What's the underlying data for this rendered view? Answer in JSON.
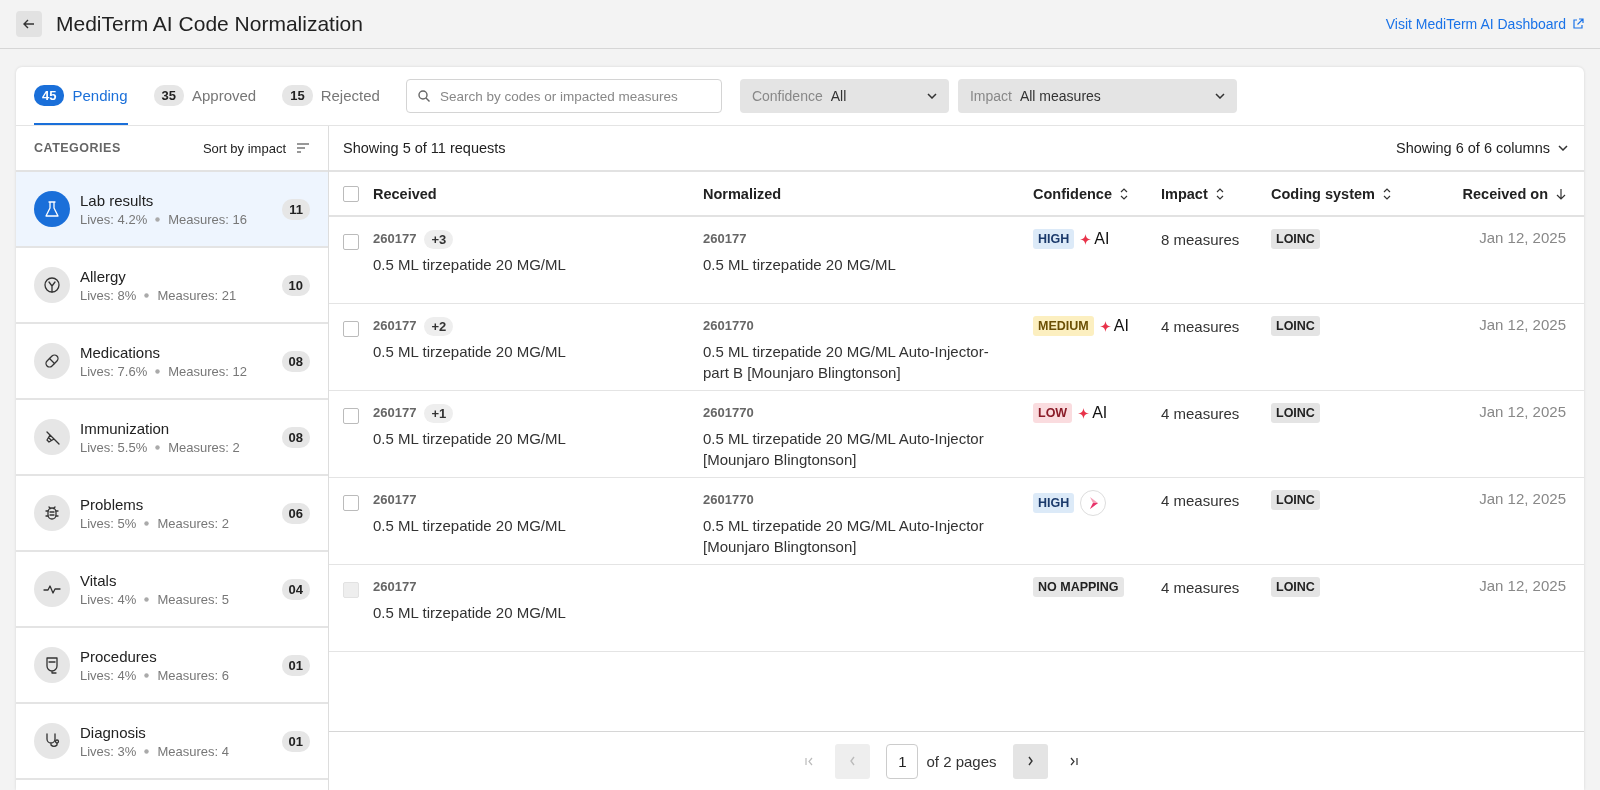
{
  "header": {
    "title": "MediTerm AI Code Normalization",
    "link": "Visit MediTerm AI Dashboard"
  },
  "tabs": [
    {
      "count": "45",
      "label": "Pending",
      "selected": true
    },
    {
      "count": "35",
      "label": "Approved",
      "selected": false
    },
    {
      "count": "15",
      "label": "Rejected",
      "selected": false
    }
  ],
  "search": {
    "placeholder": "Search by codes or impacted measures"
  },
  "filters": [
    {
      "label": "Confidence",
      "value": "All"
    },
    {
      "label": "Impact",
      "value": "All measures"
    }
  ],
  "sidebar": {
    "title": "CATEGORIES",
    "sort": "Sort by impact",
    "items": [
      {
        "name": "Lab results",
        "lives": "Lives: 4.2%",
        "measures": "Measures: 16",
        "count": "11",
        "selected": true
      },
      {
        "name": "Allergy",
        "lives": "Lives: 8%",
        "measures": "Measures: 21",
        "count": "10",
        "selected": false
      },
      {
        "name": "Medications",
        "lives": "Lives: 7.6%",
        "measures": "Measures: 12",
        "count": "08",
        "selected": false
      },
      {
        "name": "Immunization",
        "lives": "Lives: 5.5%",
        "measures": "Measures: 2",
        "count": "08",
        "selected": false
      },
      {
        "name": "Problems",
        "lives": "Lives: 5%",
        "measures": "Measures: 2",
        "count": "06",
        "selected": false
      },
      {
        "name": "Vitals",
        "lives": "Lives: 4%",
        "measures": "Measures: 5",
        "count": "04",
        "selected": false
      },
      {
        "name": "Procedures",
        "lives": "Lives: 4%",
        "measures": "Measures: 6",
        "count": "01",
        "selected": false
      },
      {
        "name": "Diagnosis",
        "lives": "Lives: 3%",
        "measures": "Measures: 4",
        "count": "01",
        "selected": false
      }
    ]
  },
  "table": {
    "summary": "Showing 5 of 11 requests",
    "columns_toggle": "Showing 6 of 6 columns",
    "select_all": {
      "checked": false
    },
    "columns": [
      {
        "label": "Received",
        "kind": "plain"
      },
      {
        "label": "Normalized",
        "kind": "plain"
      },
      {
        "label": "Confidence",
        "kind": "sortable"
      },
      {
        "label": "Impact",
        "kind": "sortable"
      },
      {
        "label": "Coding system",
        "kind": "sortable"
      },
      {
        "label": "Received on",
        "kind": "sorted"
      }
    ],
    "rows": [
      {
        "checked": false,
        "disabled": false,
        "received_code": "260177",
        "extra": "+3",
        "received_name": "0.5 ML tirzepatide 20 MG/ML",
        "normalized_code": "260177",
        "normalized_name": "0.5 ML tirzepatide 20 MG/ML",
        "confidence": {
          "kind": "high",
          "label": "HIGH"
        },
        "source": {
          "kind": "ai",
          "label": "AI"
        },
        "impact": "8 measures",
        "coding_system": "LOINC",
        "date": "Jan 12, 2025"
      },
      {
        "checked": false,
        "disabled": false,
        "received_code": "260177",
        "extra": "+2",
        "received_name": "0.5 ML tirzepatide 20 MG/ML",
        "normalized_code": "2601770",
        "normalized_name": "0.5 ML tirzepatide 20 MG/ML Auto-Injector-part B [Mounjaro Blingtonson]",
        "confidence": {
          "kind": "medium",
          "label": "MEDIUM"
        },
        "source": {
          "kind": "ai",
          "label": "AI"
        },
        "impact": "4 measures",
        "coding_system": "LOINC",
        "date": "Jan 12, 2025"
      },
      {
        "checked": false,
        "disabled": false,
        "received_code": "260177",
        "extra": "+1",
        "received_name": "0.5 ML tirzepatide 20 MG/ML",
        "normalized_code": "2601770",
        "normalized_name": "0.5 ML tirzepatide 20 MG/ML Auto-Injector [Mounjaro Blingtonson]",
        "confidence": {
          "kind": "low",
          "label": "LOW"
        },
        "source": {
          "kind": "ai",
          "label": "AI"
        },
        "impact": "4 measures",
        "coding_system": "LOINC",
        "date": "Jan 12, 2025"
      },
      {
        "checked": false,
        "disabled": false,
        "received_code": "260177",
        "received_name": "0.5 ML tirzepatide 20 MG/ML",
        "normalized_code": "2601770",
        "normalized_name": "0.5 ML tirzepatide 20 MG/ML Auto-Injector [Mounjaro Blingtonson]",
        "confidence": {
          "kind": "high",
          "label": "HIGH"
        },
        "source": {
          "kind": "logo"
        },
        "impact": "4 measures",
        "coding_system": "LOINC",
        "date": "Jan 12, 2025"
      },
      {
        "checked": false,
        "disabled": true,
        "received_code": "260177",
        "received_name": "0.5 ML tirzepatide 20 MG/ML",
        "confidence": {
          "kind": "none",
          "label": "NO MAPPING"
        },
        "impact": "4 measures",
        "coding_system": "LOINC",
        "date": "Jan 12, 2025"
      }
    ]
  },
  "pagination": {
    "page": "1",
    "of": "of 2 pages",
    "first_disabled": true,
    "prev_disabled": true,
    "next_disabled": false,
    "last_disabled": false
  }
}
